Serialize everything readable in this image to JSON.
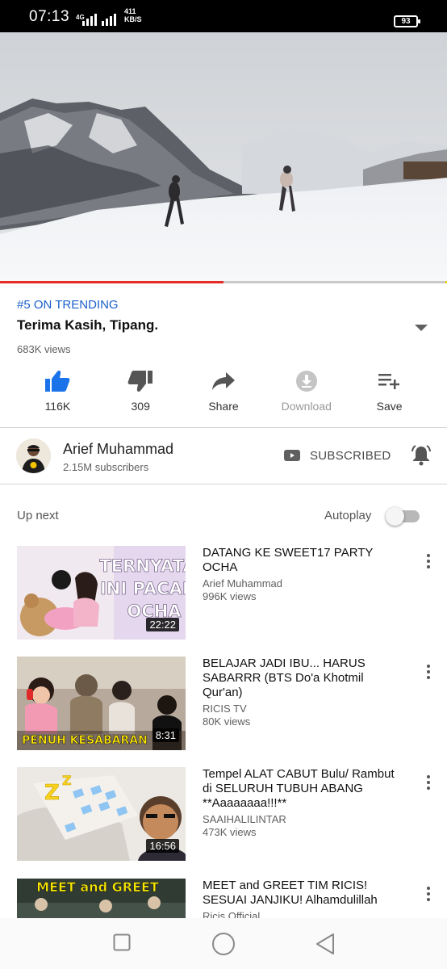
{
  "status_bar": {
    "time": "07:13",
    "network": "4G",
    "speed_value": "411",
    "speed_unit": "KB/S",
    "battery": "93"
  },
  "player": {
    "progress": 0.5,
    "colors": {
      "played": "#e52d27",
      "buffer_end": "#f2d500"
    }
  },
  "video": {
    "trending": "#5 ON TRENDING",
    "title": "Terima Kasih, Tipang.",
    "views": "683K views"
  },
  "actions": [
    {
      "label": "116K",
      "icon": "thumb-up-icon"
    },
    {
      "label": "309",
      "icon": "thumb-down-icon"
    },
    {
      "label": "Share",
      "icon": "share-icon"
    },
    {
      "label": "Download",
      "icon": "download-icon"
    },
    {
      "label": "Save",
      "icon": "playlist-add-icon"
    }
  ],
  "channel": {
    "name": "Arief Muhammad",
    "subscribers": "2.15M subscribers",
    "subscribe_label": "SUBSCRIBED"
  },
  "up_next": {
    "label": "Up next",
    "autoplay_label": "Autoplay",
    "autoplay_on": false
  },
  "videos": [
    {
      "title": "DATANG KE SWEET17 PARTY OCHA",
      "channel": "Arief Muhammad",
      "views": "996K views",
      "duration": "22:22",
      "thumb_text": [
        "TERNYATA",
        "INI PACAR",
        "OCHA"
      ]
    },
    {
      "title": "BELAJAR JADI IBU... HARUS SABARRR (BTS Do'a Khotmil Qur'an)",
      "channel": "RICIS TV",
      "views": "80K views",
      "duration": "8:31",
      "thumb_text": [
        "PENUH KESABARAN"
      ]
    },
    {
      "title": "Tempel ALAT CABUT Bulu/ Rambut di SELURUH TUBUH ABANG **Aaaaaaaa!!!**",
      "channel": "SAAIHALILINTAR",
      "views": "473K views",
      "duration": "16:56",
      "thumb_text": []
    },
    {
      "title": "MEET and GREET TIM RICIS! SESUAI JANJIKU! Alhamdulillah",
      "channel": "Ricis Official",
      "views": "",
      "duration": "",
      "thumb_text": [
        "MEET and GREET"
      ]
    }
  ]
}
